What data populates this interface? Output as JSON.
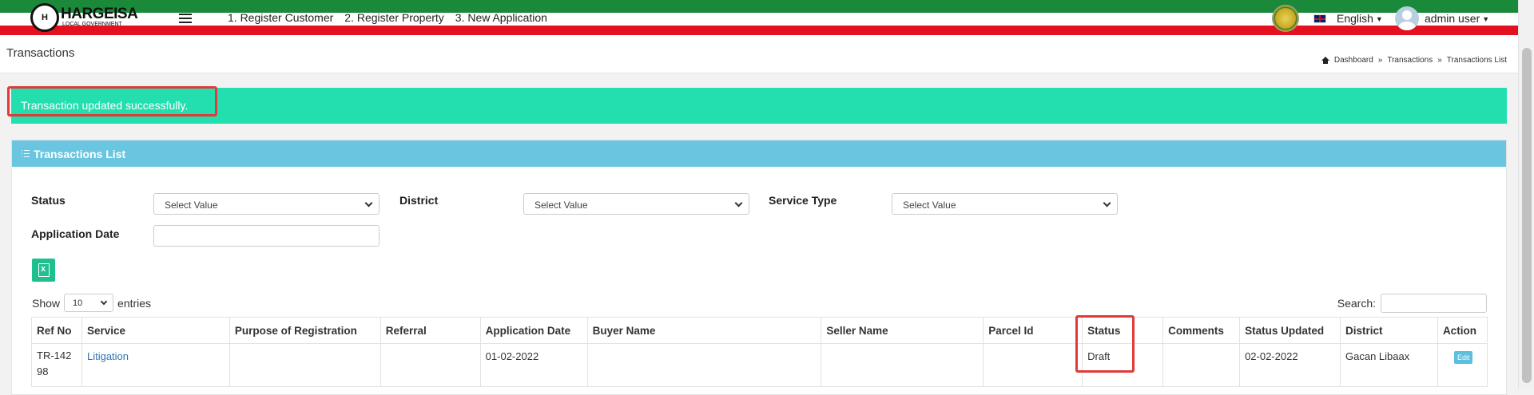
{
  "topbar": {
    "logo_title": "HARGEISA",
    "logo_subtitle": "LOCAL GOVERNMENT",
    "nav": [
      "1. Register Customer",
      "2. Register Property",
      "3. New Application"
    ],
    "language": "English",
    "user": "admin user"
  },
  "header": {
    "title": "Transactions",
    "breadcrumb": [
      "Dashboard",
      "Transactions",
      "Transactions List"
    ]
  },
  "alert": {
    "message": "Transaction updated successfully."
  },
  "panel": {
    "title": "Transactions List",
    "filters": {
      "status_label": "Status",
      "status_value": "Select Value",
      "district_label": "District",
      "district_value": "Select Value",
      "service_label": "Service Type",
      "service_value": "Select Value",
      "date_label": "Application Date",
      "date_value": ""
    },
    "show_label": "Show",
    "entries_value": "10",
    "entries_label": "entries",
    "search_label": "Search:"
  },
  "table": {
    "columns": [
      "Ref No",
      "Service",
      "Purpose of Registration",
      "Referral",
      "Application Date",
      "Buyer Name",
      "Seller Name",
      "Parcel Id",
      "Status",
      "Comments",
      "Status Updated",
      "District",
      "Action"
    ],
    "rows": [
      {
        "ref_no": "TR-14298",
        "service": "Litigation",
        "purpose": "",
        "referral": "",
        "application_date": "01-02-2022",
        "buyer": "",
        "seller": "",
        "parcel": "",
        "status": "Draft",
        "comments": "",
        "status_updated": "02-02-2022",
        "district": "Gacan Libaax",
        "action": "Edit"
      }
    ]
  },
  "colors": {
    "flag_green": "#1a8a3a",
    "flag_red": "#e3101f",
    "alert_bg": "#23dfb0",
    "panel_header": "#69c5e0",
    "highlight": "#e03a3a",
    "link": "#2f72b8"
  }
}
